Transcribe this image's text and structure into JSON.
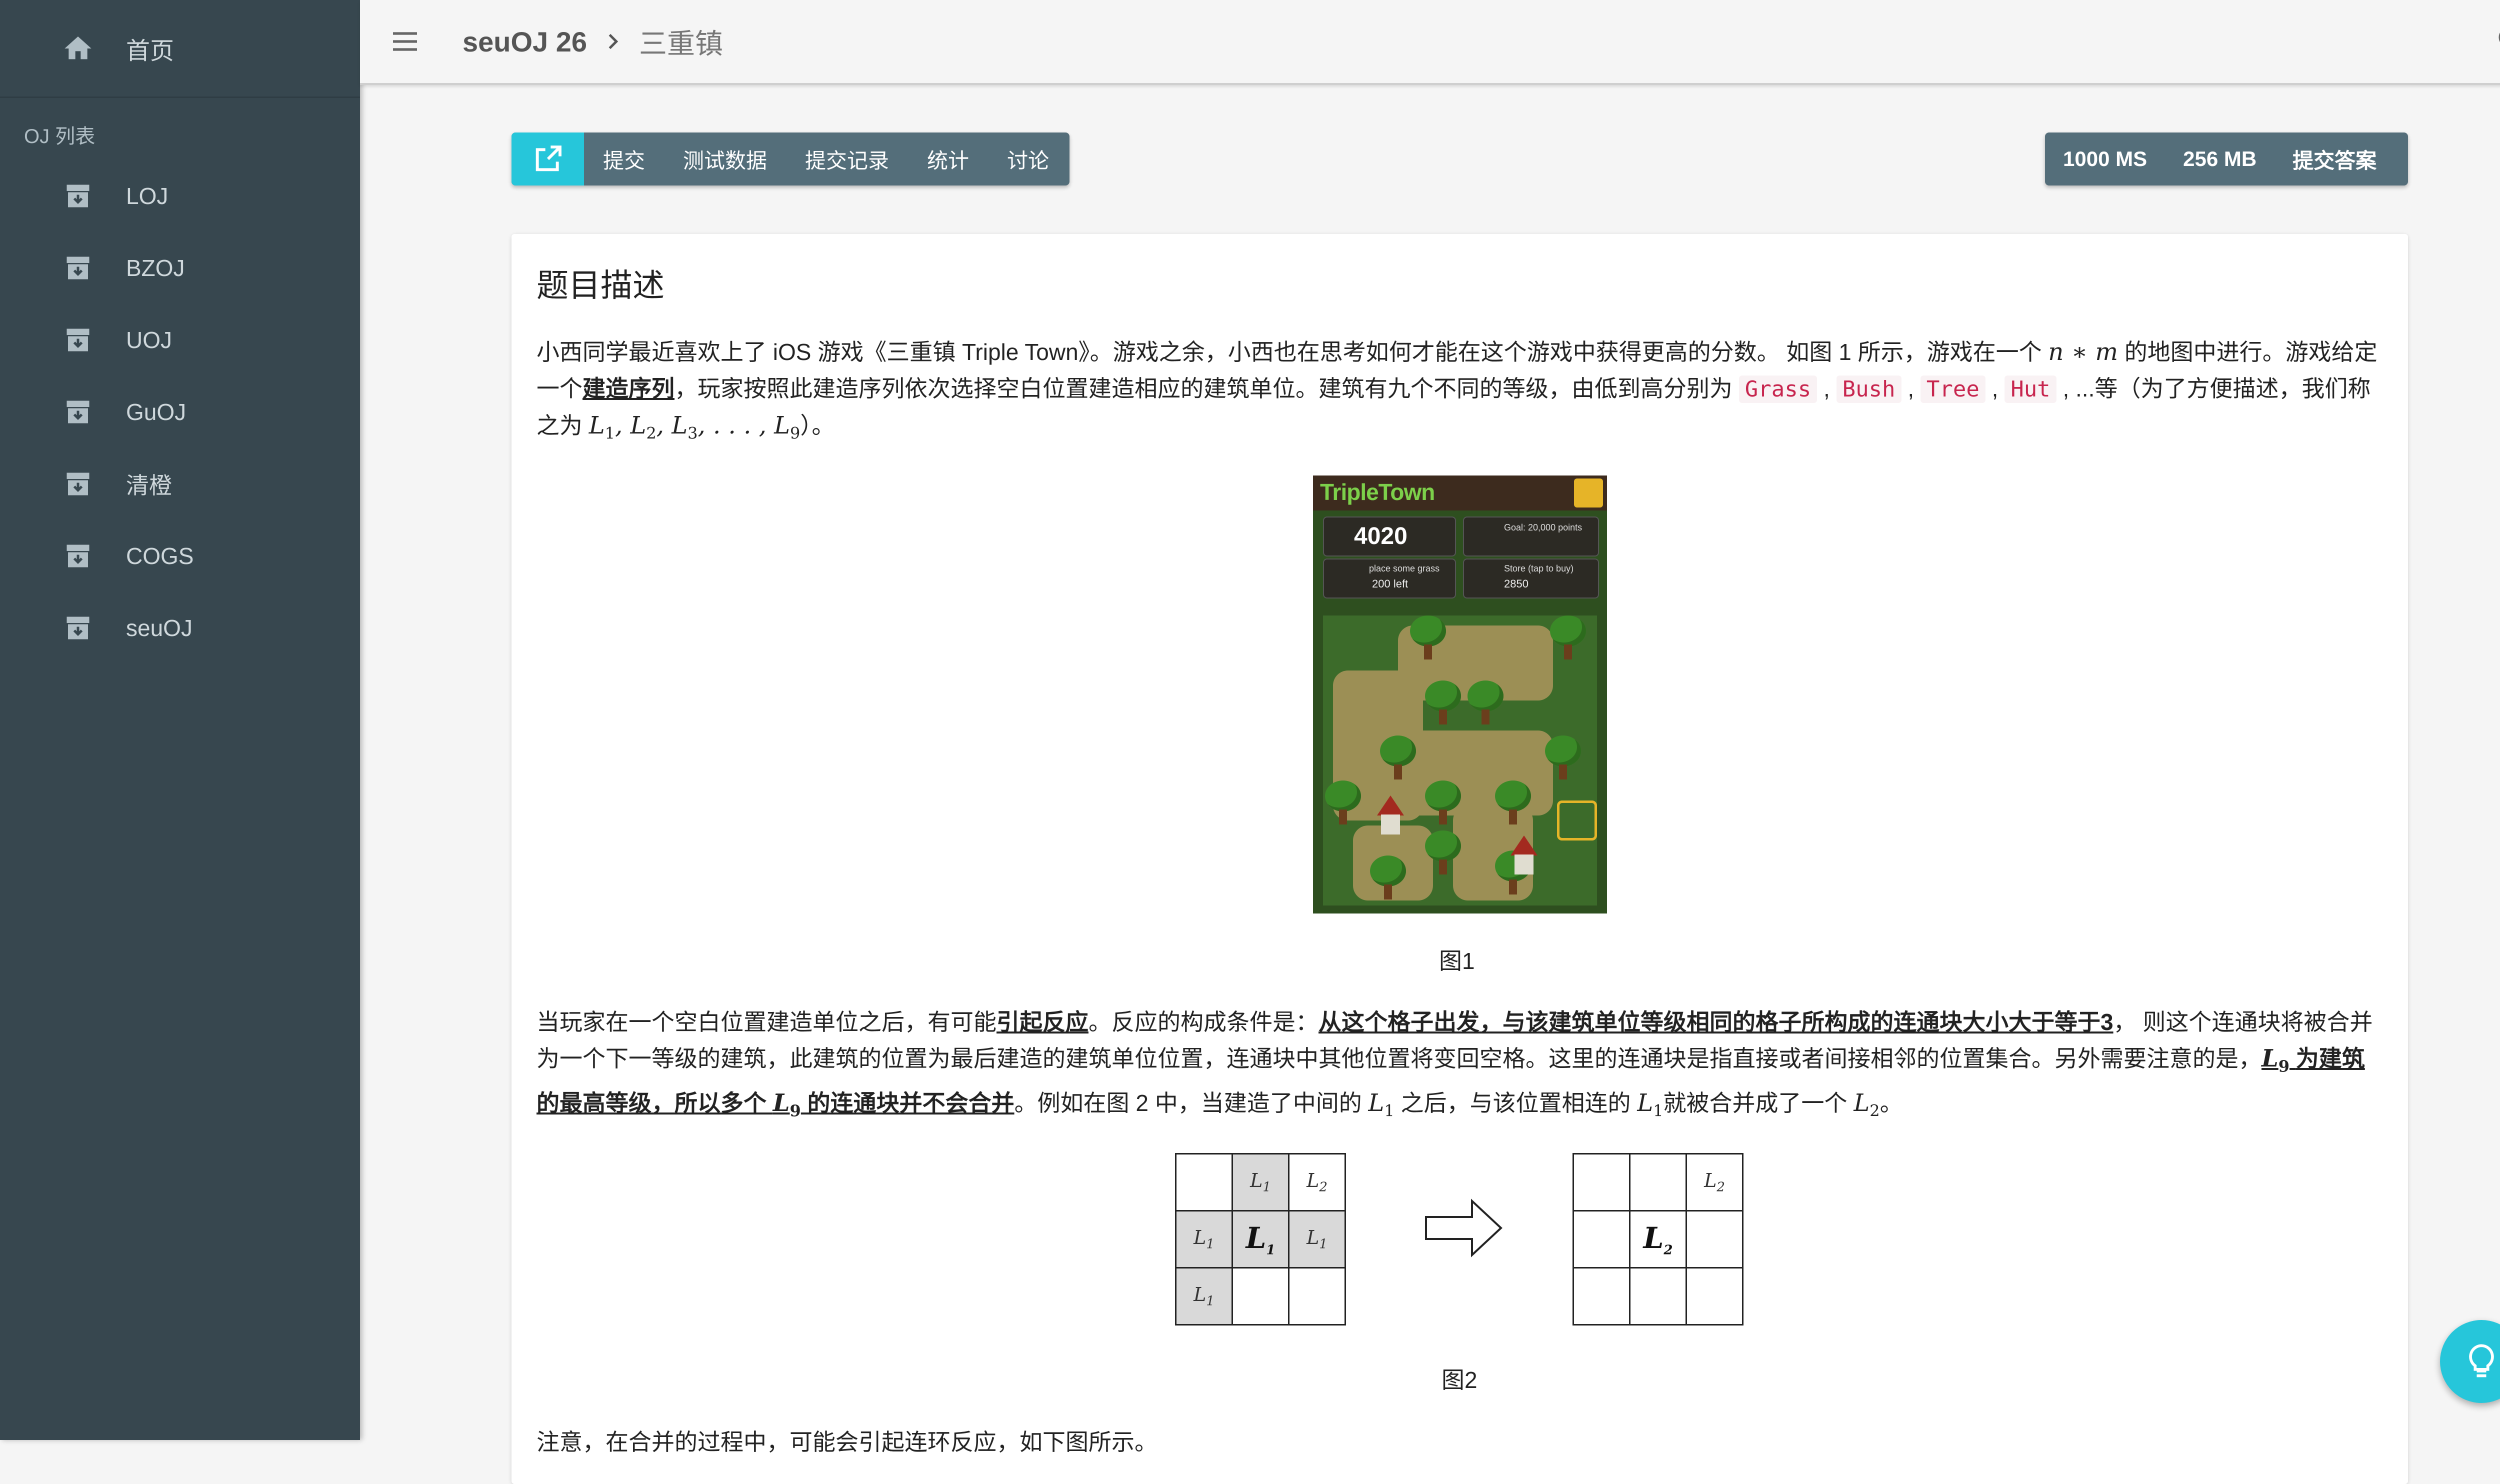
{
  "sidebar": {
    "home_label": "首页",
    "section_label": "OJ 列表",
    "items": [
      {
        "label": "LOJ"
      },
      {
        "label": "BZOJ"
      },
      {
        "label": "UOJ"
      },
      {
        "label": "GuOJ"
      },
      {
        "label": "清橙"
      },
      {
        "label": "COGS"
      },
      {
        "label": "seuOJ"
      }
    ]
  },
  "topbar": {
    "oj_name": "seuOJ 26",
    "problem_title": "三重镇"
  },
  "toolbar_left": {
    "submit": "提交",
    "testdata": "测试数据",
    "records": "提交记录",
    "stats": "统计",
    "discuss": "讨论"
  },
  "toolbar_right": {
    "time_limit": "1000 MS",
    "memory_limit": "256 MB",
    "submit_answer": "提交答案"
  },
  "content": {
    "section_title": "题目描述",
    "p1_a": "小西同学最近喜欢上了 iOS 游戏《三重镇 Triple Town》。游戏之余，小西也在思考如何才能在这个游戏中获得更高的分数。 如图 1 所示，游戏在一个 ",
    "p1_math_nm": "n ∗ m",
    "p1_b": " 的地图中进行。游戏给定一个",
    "p1_emph": "建造序列",
    "p1_c": "，玩家按照此建造序列依次选择空白位置建造相应的建筑单位。建筑有九个不同的等级，由低到高分别为 ",
    "code_grass": "Grass",
    "code_bush": "Bush",
    "code_tree": "Tree",
    "code_hut": "Hut",
    "p1_d": " , ...等（为了方便描述，我们称之为 ",
    "p1_e": "）。",
    "fig1_caption": "图1",
    "p2_a": "当玩家在一个空白位置建造单位之后，有可能",
    "p2_emph1": "引起反应",
    "p2_b": "。反应的构成条件是：",
    "p2_emph2": "从这个格子出发，与该建筑单位等级相同的格子所构成的连通块大小大于等于3",
    "p2_c": "， 则这个连通块将被合并为一个下一等级的建筑，此建筑的位置为最后建造的建筑单位位置，连通块中其他位置将变回空格。这里的连通块是指直接或者间接相邻的位置集合。另外需要注意的是，",
    "p2_emph3a": "为建筑的最高等级，所以多个 ",
    "p2_emph3b": " 的连通块并不会合并",
    "p2_d": "。例如在图 2 中，当建造了中间的 ",
    "p2_e": " 之后，与该位置相连的 ",
    "p2_f": "就被合并成了一个 ",
    "p2_g": "。",
    "fig2_caption": "图2",
    "p3": "注意，在合并的过程中，可能会引起连环反应，如下图所示。"
  },
  "game": {
    "logo": "TripleTown",
    "score": "4020",
    "goal_label": "Goal: 20,000 points",
    "place_label": "place some grass",
    "place_value": "200 left",
    "store_label": "Store (tap to buy)",
    "store_value": "2850"
  },
  "colors": {
    "sidebar_bg": "#37474f",
    "toolbar_bg": "#546e7a",
    "accent": "#26c6da",
    "code_fg": "#c7254e"
  }
}
